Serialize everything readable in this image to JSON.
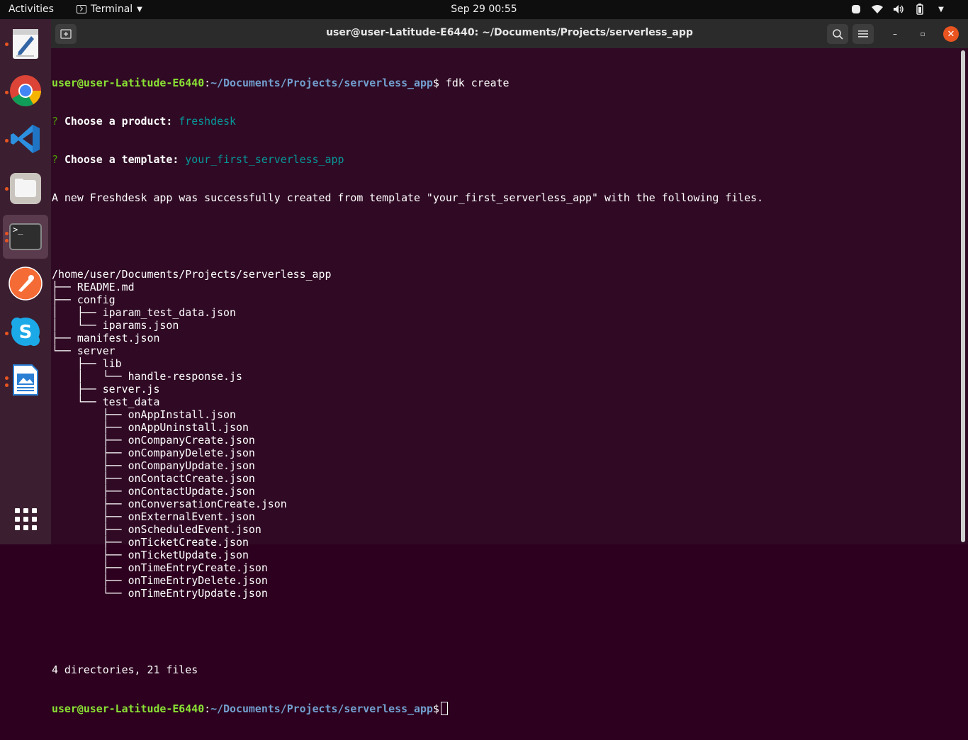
{
  "topbar": {
    "activities": "Activities",
    "app_name": "Terminal",
    "clock": "Sep 29  00:55"
  },
  "dock": {
    "items": [
      {
        "name": "text-editor",
        "color": "#f6f6f6"
      },
      {
        "name": "chrome",
        "color": "#4285f4"
      },
      {
        "name": "vscode",
        "color": "#2d8fe0"
      },
      {
        "name": "files",
        "color": "#c9c4bd"
      },
      {
        "name": "terminal",
        "color": "#2e2e2e"
      },
      {
        "name": "postman",
        "color": "#f56b36"
      },
      {
        "name": "skype",
        "color": "#1ca9e8"
      },
      {
        "name": "libreoffice-writer",
        "color": "#2a7fd4"
      }
    ]
  },
  "window": {
    "title": "user@user-Latitude-E6440: ~/Documents/Projects/serverless_app"
  },
  "terminal": {
    "prompt_user": "user@user-Latitude-E6440",
    "prompt_path": "~/Documents/Projects/serverless_app",
    "prompt_sym": "$",
    "command": " fdk create",
    "q1_label": "Choose a product:",
    "q1_value": "freshdesk",
    "q2_label": "Choose a template:",
    "q2_value": "your_first_serverless_app",
    "success": "A new Freshdesk app was successfully created from template \"your_first_serverless_app\" with the following files.",
    "tree": [
      "/home/user/Documents/Projects/serverless_app",
      "├── README.md",
      "├── config",
      "│   ├── iparam_test_data.json",
      "│   └── iparams.json",
      "├── manifest.json",
      "└── server",
      "    ├── lib",
      "    │   └── handle-response.js",
      "    ├── server.js",
      "    └── test_data",
      "        ├── onAppInstall.json",
      "        ├── onAppUninstall.json",
      "        ├── onCompanyCreate.json",
      "        ├── onCompanyDelete.json",
      "        ├── onCompanyUpdate.json",
      "        ├── onContactCreate.json",
      "        ├── onContactUpdate.json",
      "        ├── onConversationCreate.json",
      "        ├── onExternalEvent.json",
      "        ├── onScheduledEvent.json",
      "        ├── onTicketCreate.json",
      "        ├── onTicketUpdate.json",
      "        ├── onTimeEntryCreate.json",
      "        ├── onTimeEntryDelete.json",
      "        └── onTimeEntryUpdate.json"
    ],
    "summary": "4 directories, 21 files"
  }
}
